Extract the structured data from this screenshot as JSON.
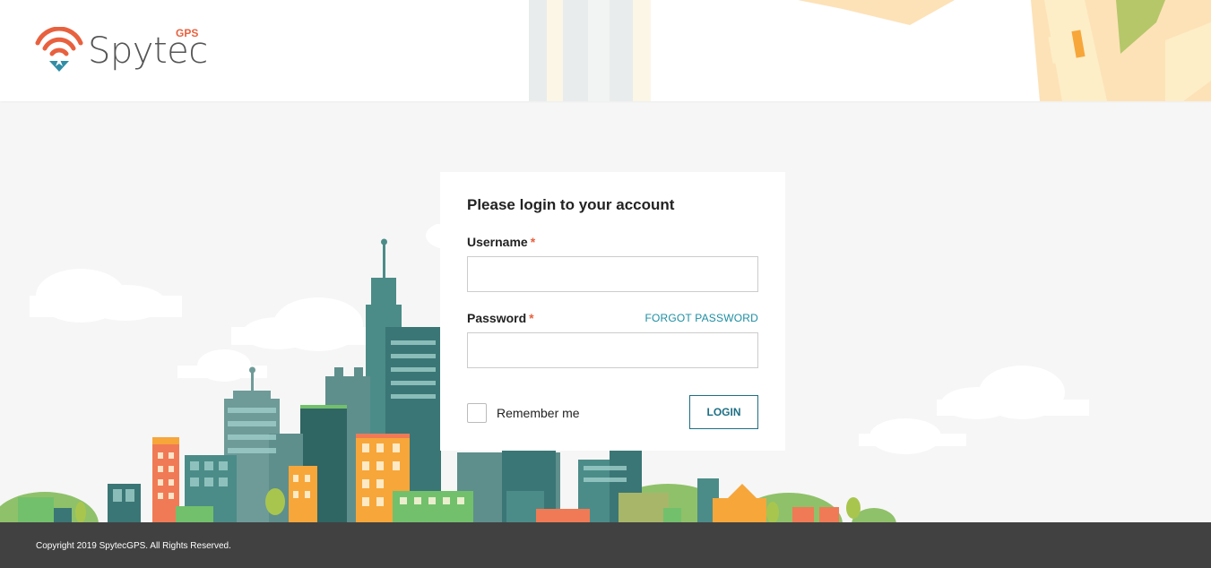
{
  "brand": {
    "name": "Spytec",
    "suffix": "GPS",
    "color": "#e8613f"
  },
  "login": {
    "title": "Please login to your account",
    "username_label": "Username",
    "password_label": "Password",
    "required_mark": "*",
    "forgot_label": "FORGOT PASSWORD",
    "username_value": "",
    "password_value": "",
    "remember_label": "Remember me",
    "remember_checked": false,
    "login_label": "LOGIN"
  },
  "footer": {
    "copyright": "Copyright 2019 SpytecGPS. All Rights Reserved."
  },
  "colors": {
    "accent": "#1d8ea3",
    "button": "#1d6f84",
    "footer": "#414141",
    "background": "#f6f6f6"
  }
}
